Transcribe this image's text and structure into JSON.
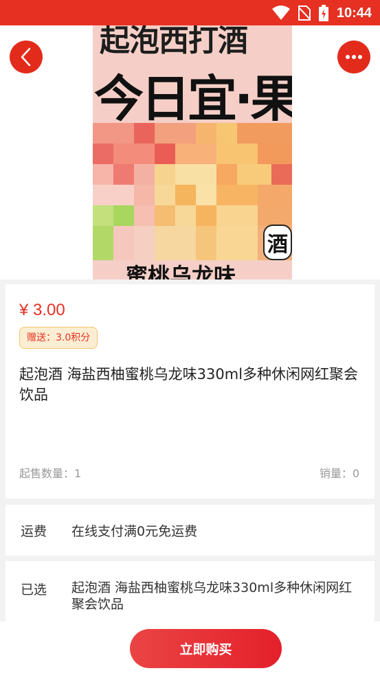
{
  "status_bar": {
    "time": "10:44",
    "icons": [
      "wifi-icon",
      "no-sim-icon",
      "battery-charging-icon"
    ]
  },
  "product_image": {
    "text_line_1": "起泡西打酒",
    "text_line_2": "今日宜·果酿",
    "badge": "酒",
    "text_line_3": "蜜桃乌龙味"
  },
  "nav": {
    "back_icon": "chevron-left-icon",
    "more_icon": "more-dots-icon"
  },
  "product": {
    "price": "¥ 3.00",
    "points": "赠送：3.0积分",
    "title": "起泡酒 海盐西柚蜜桃乌龙味330ml多种休闲网红聚会饮品",
    "min_qty": "起售数量：1",
    "sales": "销量：0"
  },
  "shipping": {
    "label": "运费",
    "value": "在线支付满0元免运费"
  },
  "selected": {
    "label": "已选",
    "value": "起泡酒 海盐西柚蜜桃乌龙味330ml多种休闲网红聚会饮品"
  },
  "actions": {
    "buy_now": "立即购买"
  },
  "colors": {
    "brand": "#e53022",
    "badge_bg": "#fdeed3",
    "badge_border": "#f3c16c"
  }
}
